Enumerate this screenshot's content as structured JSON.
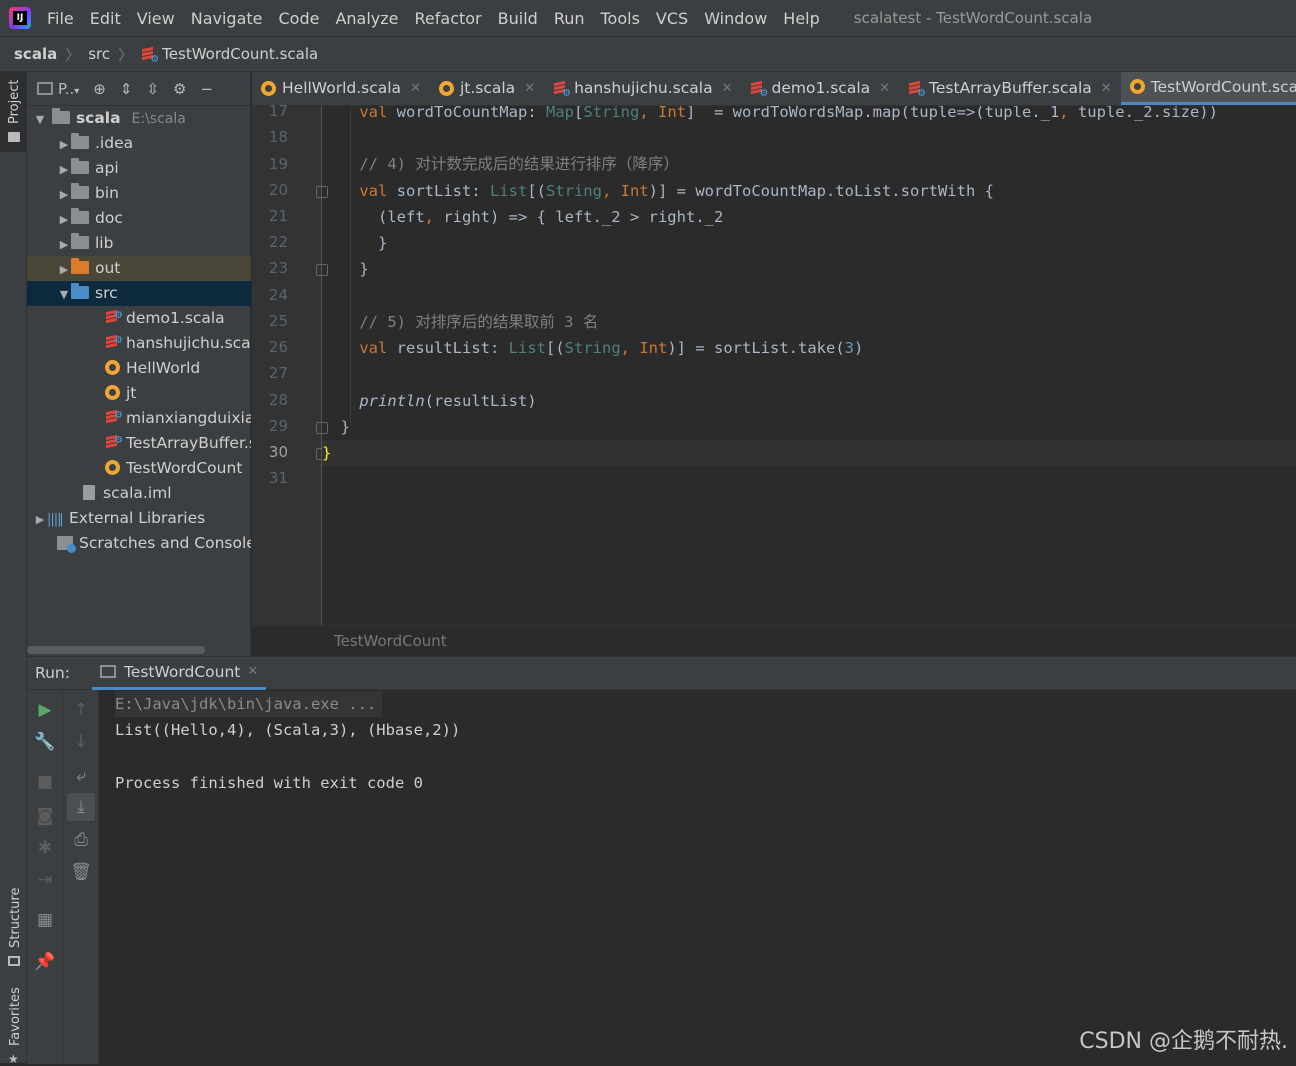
{
  "menubar": {
    "items": [
      "File",
      "Edit",
      "View",
      "Navigate",
      "Code",
      "Analyze",
      "Refactor",
      "Build",
      "Run",
      "Tools",
      "VCS",
      "Window",
      "Help"
    ],
    "window_title": "scalatest - TestWordCount.scala"
  },
  "navbar": {
    "crumbs": [
      "scala",
      "src",
      "TestWordCount.scala"
    ]
  },
  "sidebar_tabs": {
    "project": "Project",
    "structure": "Structure",
    "favorites": "Favorites"
  },
  "project": {
    "toolbar_label": "P..",
    "tree": [
      {
        "label": "scala",
        "extra": "E:\\scala",
        "type": "module",
        "depth": 0,
        "expanded": true
      },
      {
        "label": ".idea",
        "type": "folder",
        "depth": 1
      },
      {
        "label": "api",
        "type": "folder",
        "depth": 1
      },
      {
        "label": "bin",
        "type": "folder",
        "depth": 1
      },
      {
        "label": "doc",
        "type": "folder",
        "depth": 1
      },
      {
        "label": "lib",
        "type": "folder",
        "depth": 1
      },
      {
        "label": "out",
        "type": "folder-orange",
        "depth": 1
      },
      {
        "label": "src",
        "type": "folder-blue",
        "depth": 1,
        "expanded": true
      },
      {
        "label": "demo1.scala",
        "type": "scala",
        "depth": 2
      },
      {
        "label": "hanshujichu.scala",
        "type": "scala",
        "depth": 2
      },
      {
        "label": "HellWorld",
        "type": "object",
        "depth": 2
      },
      {
        "label": "jt",
        "type": "object",
        "depth": 2
      },
      {
        "label": "mianxiangduixian",
        "type": "scala",
        "depth": 2
      },
      {
        "label": "TestArrayBuffer.s",
        "type": "scala",
        "depth": 2
      },
      {
        "label": "TestWordCount",
        "type": "object",
        "depth": 2
      },
      {
        "label": "scala.iml",
        "type": "iml",
        "depth": 1
      },
      {
        "label": "External Libraries",
        "type": "libs",
        "depth": 0
      },
      {
        "label": "Scratches and Consoles",
        "type": "scratch",
        "depth": 0
      }
    ]
  },
  "tabs": [
    {
      "label": "HellWorld.scala",
      "icon": "object-icon"
    },
    {
      "label": "jt.scala",
      "icon": "object-icon"
    },
    {
      "label": "hanshujichu.scala",
      "icon": "scala-file-icon"
    },
    {
      "label": "demo1.scala",
      "icon": "scala-file-icon"
    },
    {
      "label": "TestArrayBuffer.scala",
      "icon": "scala-file-icon"
    },
    {
      "label": "TestWordCount.scala",
      "icon": "object-icon",
      "active": true
    }
  ],
  "editor": {
    "line_numbers": [
      "17",
      "18",
      "19",
      "20",
      "21",
      "22",
      "23",
      "24",
      "25",
      "26",
      "27",
      "28",
      "29",
      "30",
      "31"
    ],
    "current_line": "30",
    "breadcrumb": "TestWordCount"
  },
  "run": {
    "label": "Run:",
    "tab": "TestWordCount",
    "console": [
      "E:\\Java\\jdk\\bin\\java.exe ...",
      "List((Hello,4), (Scala,3), (Hbase,2))",
      "",
      "Process finished with exit code 0"
    ]
  },
  "watermark": "CSDN @企鹅不耐热."
}
